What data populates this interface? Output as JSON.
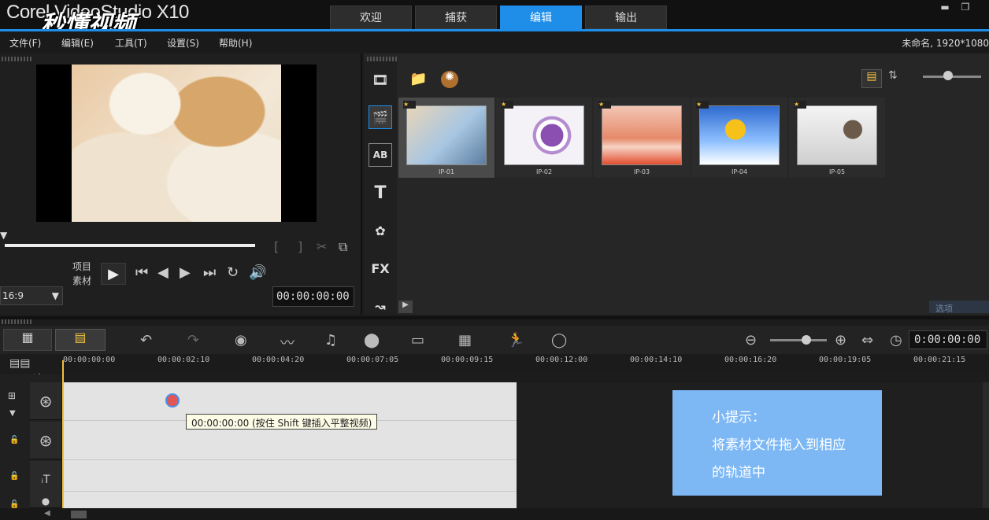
{
  "app": {
    "logo_text": "Corel VideoStudio X10",
    "watermark": "秒懂视频",
    "project_info": "未命名, 1920*1080"
  },
  "tabs": [
    {
      "label": "欢迎",
      "active": false
    },
    {
      "label": "捕获",
      "active": false
    },
    {
      "label": "编辑",
      "active": true
    },
    {
      "label": "输出",
      "active": false
    }
  ],
  "menu": {
    "file": "文件(F)",
    "edit": "编辑(E)",
    "tools": "工具(T)",
    "settings": "设置(S)",
    "help": "帮助(H)"
  },
  "player": {
    "mode_project": "项目",
    "mode_clip": "素材",
    "aspect": "16:9",
    "timecode": "00:00:00:00"
  },
  "library": {
    "thumbnails": [
      {
        "label": "IP-01",
        "selected": true
      },
      {
        "label": "IP-02",
        "selected": false
      },
      {
        "label": "IP-03",
        "selected": false
      },
      {
        "label": "IP-04",
        "selected": false
      },
      {
        "label": "IP-05",
        "selected": false
      }
    ],
    "sidebar": {
      "fx": "FX",
      "title": "T",
      "ab": "AB"
    },
    "options_label": "选项"
  },
  "timeline": {
    "timecode": "0:00:00:00",
    "ruler": [
      "00:00:00:00",
      "00:00:02:10",
      "00:00:04:20",
      "00:00:07:05",
      "00:00:09:15",
      "00:00:12:00",
      "00:00:14:10",
      "00:00:16:20",
      "00:00:19:05",
      "00:00:21:15"
    ],
    "tooltip": "00:00:00:00 (按住 Shift 键插入平整视频)",
    "track_controls": "+/-"
  },
  "hint": {
    "line1": "小提示：",
    "line2": "将素材文件拖入到相应",
    "line3": "的轨道中"
  },
  "colors": {
    "accent": "#1e8ee8",
    "hint_bg": "#7db8f5"
  }
}
